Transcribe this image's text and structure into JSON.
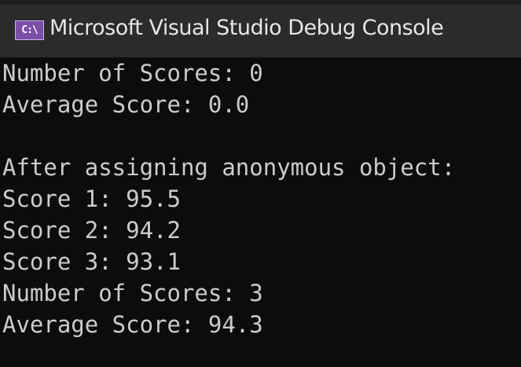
{
  "window": {
    "title": "Microsoft Visual Studio Debug Console",
    "icon_text": "C:\\"
  },
  "console": {
    "lines": [
      "Number of Scores: 0",
      "Average Score: 0.0",
      "",
      "After assigning anonymous object:",
      "Score 1: 95.5",
      "Score 2: 94.2",
      "Score 3: 93.1",
      "Number of Scores: 3",
      "Average Score: 94.3"
    ]
  },
  "colors": {
    "background": "#0c0c0c",
    "titlebar": "#2b2b2b",
    "text": "#cccccc",
    "icon": "#7a4fa8"
  }
}
